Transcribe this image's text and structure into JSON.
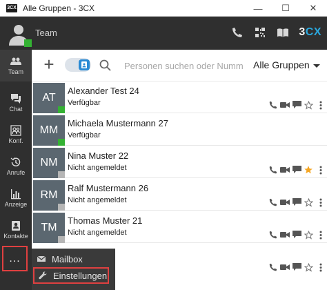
{
  "window": {
    "title": "Alle Gruppen - 3CX",
    "logo_text": "3CX",
    "minimize": "—",
    "maximize": "☐",
    "close": "✕"
  },
  "header": {
    "title": "Team",
    "brand_prefix": "3",
    "brand_suffix": "CX",
    "icons": [
      "phone-icon",
      "qr-code-icon",
      "phonebook-icon"
    ]
  },
  "sidebar": {
    "items": [
      {
        "label": "Team",
        "icon": "team-icon",
        "active": true
      },
      {
        "label": "Chat",
        "icon": "chat-icon"
      },
      {
        "label": "Konf.",
        "icon": "conference-icon"
      },
      {
        "label": "Anrufe",
        "icon": "history-icon"
      },
      {
        "label": "Anzeige",
        "icon": "chart-icon"
      },
      {
        "label": "Kontakte",
        "icon": "contacts-icon"
      }
    ],
    "more_label": "..."
  },
  "more_menu": {
    "mailbox": "Mailbox",
    "settings": "Einstellungen"
  },
  "toolbar": {
    "add_label": "+",
    "search_placeholder": "Personen suchen oder Numm",
    "group_label": "Alle Gruppen"
  },
  "colors": {
    "dark_bg": "#2f2f2f",
    "accent_blue": "#2a8ad4",
    "online_green": "#34b233",
    "star_orange": "#f5a623",
    "highlight_red": "#e04040"
  },
  "contacts": [
    {
      "initials": "AT",
      "name": "Alexander Test 24",
      "status": "Verfügbar",
      "online": true,
      "favorite": false,
      "actions": true
    },
    {
      "initials": "MM",
      "name": "Michaela Mustermann 27",
      "status": "Verfügbar",
      "online": true,
      "favorite": false,
      "actions": false
    },
    {
      "initials": "NM",
      "name": "Nina Muster 22",
      "status": "Nicht angemeldet",
      "online": false,
      "favorite": true,
      "actions": true
    },
    {
      "initials": "RM",
      "name": "Ralf Mustermann 26",
      "status": "Nicht angemeldet",
      "online": false,
      "favorite": false,
      "actions": true
    },
    {
      "initials": "TM",
      "name": "Thomas Muster 21",
      "status": "Nicht angemeldet",
      "online": false,
      "favorite": false,
      "actions": true
    },
    {
      "initials": "",
      "name": "",
      "status": "",
      "online": false,
      "favorite": false,
      "actions": true
    }
  ]
}
